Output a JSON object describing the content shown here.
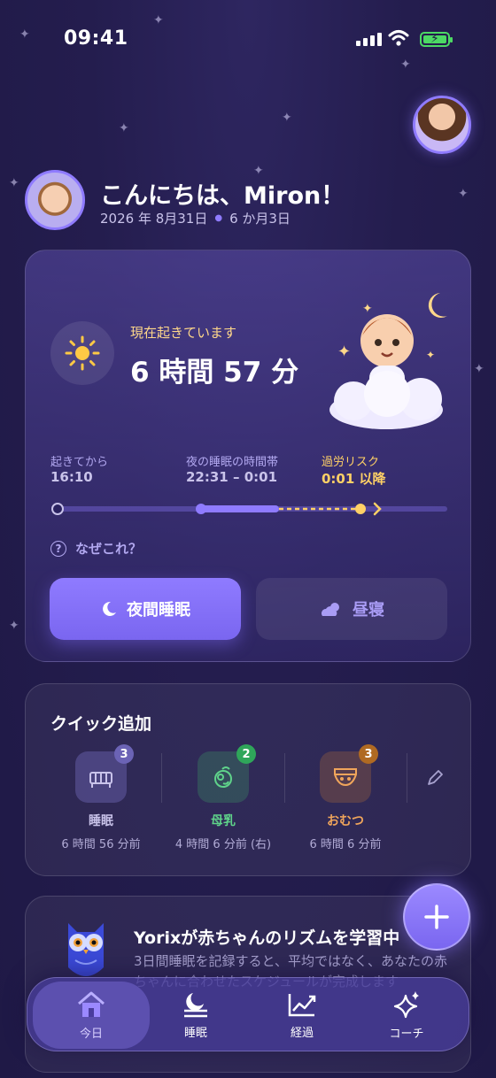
{
  "status_bar": {
    "time": "09:41"
  },
  "header": {
    "greeting": "こんにちは、Miron！",
    "date": "2026 年 8月31日",
    "age": "6 か月3日"
  },
  "awake_card": {
    "status_label": "現在起きています",
    "duration": "6 時間 57 分",
    "since_label": "起きてから",
    "since_value": "16:10",
    "window_label": "夜の睡眠の時間帯",
    "window_value": "22:31 – 0:01",
    "risk_label": "過労リスク",
    "risk_value": "0:01 以降",
    "why_label": "なぜこれ？",
    "night_button": "夜間睡眠",
    "nap_button": "昼寝"
  },
  "quick_add": {
    "title": "クイック追加",
    "items": [
      {
        "icon": "crib-icon",
        "badge": "3",
        "name": "睡眠",
        "ago": "6 時間 56 分前",
        "color": "#c9c3ea",
        "badge_color": "#6b63b5"
      },
      {
        "icon": "bottle-icon",
        "badge": "2",
        "name": "母乳",
        "ago": "4 時間 6 分前 (右)",
        "color": "#5fd38a",
        "badge_color": "#2fa65a"
      },
      {
        "icon": "diaper-icon",
        "badge": "3",
        "name": "おむつ",
        "ago": "6 時間 6 分前",
        "color": "#f0a55b",
        "badge_color": "#b06a22"
      }
    ]
  },
  "yorix": {
    "title": "Yorixが赤ちゃんのリズムを学習中",
    "text": "3日間睡眠を記録すると、平均ではなく、あなたの赤ちゃんに合わせたスケジュールが完成します"
  },
  "tabs": [
    {
      "label": "今日",
      "icon": "home-icon"
    },
    {
      "label": "睡眠",
      "icon": "sleep-icon"
    },
    {
      "label": "経過",
      "icon": "progress-chart-icon"
    },
    {
      "label": "コーチ",
      "icon": "sparkle-icon"
    }
  ],
  "colors": {
    "accent": "#8f7bff",
    "awake_label": "#ffd88a",
    "risk": "#ffd166"
  }
}
